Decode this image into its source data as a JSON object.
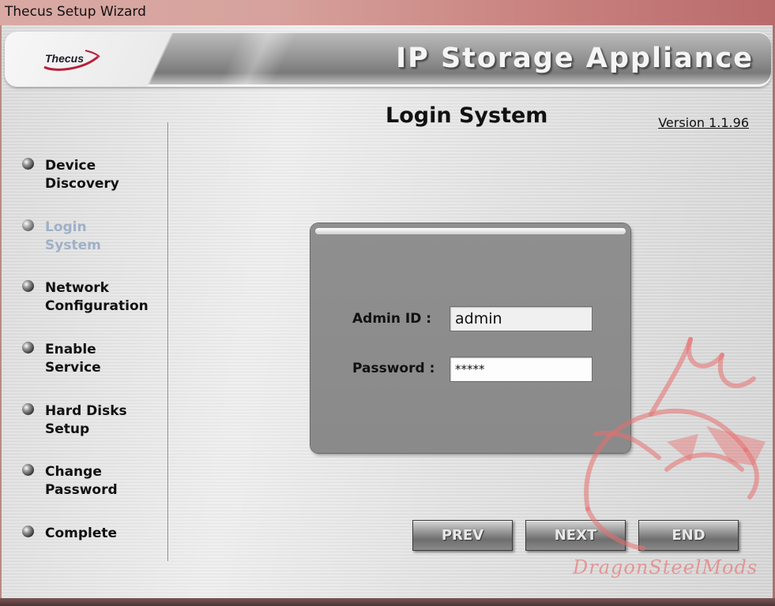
{
  "window": {
    "title": "Thecus Setup Wizard"
  },
  "banner": {
    "logo_text": "Thecus",
    "title": "IP Storage Appliance"
  },
  "sidebar": {
    "steps": [
      {
        "label": "Device\nDiscovery",
        "current": false
      },
      {
        "label": "Login\nSystem",
        "current": true
      },
      {
        "label": "Network\nConfiguration",
        "current": false
      },
      {
        "label": "Enable\nService",
        "current": false
      },
      {
        "label": "Hard Disks\nSetup",
        "current": false
      },
      {
        "label": "Change\nPassword",
        "current": false
      },
      {
        "label": "Complete",
        "current": false
      }
    ]
  },
  "main": {
    "heading": "Login System",
    "version": "Version 1.1.96",
    "form": {
      "admin_id_label": "Admin ID :",
      "admin_id_value": "admin",
      "password_label": "Password :",
      "password_value": "*****"
    }
  },
  "buttons": {
    "prev": "PREV",
    "next": "NEXT",
    "end": "END"
  },
  "watermark": {
    "text": "DragonSteelMods",
    "color": "#e87070"
  }
}
